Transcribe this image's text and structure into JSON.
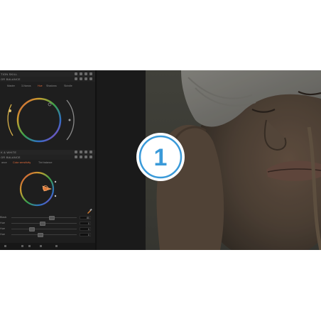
{
  "panel": {
    "header1": "TION SKILL",
    "header1_sub": "OR BALANCE",
    "tabs1": [
      "Master",
      "3-Nanos",
      "Hue",
      "Shadows",
      "Skindle"
    ],
    "tabs1_active": "Hue",
    "header2": "K & WHITE",
    "header2_sub": "OR BALANCE",
    "tabs2": [
      "ance",
      "Color sensitivity",
      "Tint balance"
    ],
    "tabs2_active": "Color sensitivity",
    "sliders": [
      {
        "label": "Black",
        "value": "80",
        "level": 0.62
      },
      {
        "label": "Hue",
        "value": "0",
        "level": 0.48
      },
      {
        "label": "Hue",
        "value": "0",
        "level": 0.32
      },
      {
        "label": "Hue",
        "value": "0",
        "level": 0.45
      }
    ]
  },
  "colors": {
    "accent": "#e06a3a",
    "logo_blue": "#3a9ad9",
    "panel_bg": "#1e1e1e"
  },
  "logo": {
    "text": "1"
  },
  "icons": {
    "panel_header_icons": [
      "pin-icon",
      "reset-icon",
      "copy-icon",
      "help-icon",
      "menu-icon"
    ],
    "bottom_bar_icons": [
      "undo-icon",
      "history-icon",
      "mask-icon",
      "brush-icon",
      "eraser-icon"
    ]
  }
}
